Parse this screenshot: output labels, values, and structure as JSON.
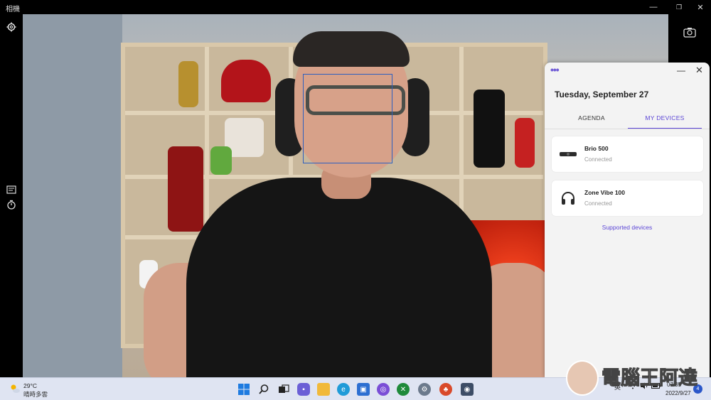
{
  "window": {
    "title": "相機",
    "controls": {
      "minimize": "—",
      "maximize": "❐",
      "close": "✕"
    }
  },
  "camera": {
    "left_toolbar": [
      "settings-icon",
      "pro-controls-icon",
      "timer-icon"
    ],
    "right_toolbar": [
      "switch-camera-icon"
    ]
  },
  "tune_panel": {
    "date": "Tuesday, September 27",
    "tabs": [
      {
        "label": "AGENDA",
        "active": false
      },
      {
        "label": "MY DEVICES",
        "active": true
      }
    ],
    "devices": [
      {
        "name": "Brio 500",
        "status": "Connected",
        "icon": "webcam-icon"
      },
      {
        "name": "Zone Vibe 100",
        "status": "Connected",
        "icon": "headphones-icon"
      }
    ],
    "supported_link": "Supported devices",
    "accent": "#5b45d6"
  },
  "taskbar": {
    "weather": {
      "temp": "29°C",
      "desc": "晴時多雲"
    },
    "apps": [
      "windows-start-icon",
      "search-icon",
      "task-view-icon",
      "teams-chat-icon",
      "file-explorer-icon",
      "edge-icon",
      "store-icon",
      "app-icon",
      "xbox-icon",
      "settings-icon",
      "game-icon",
      "camera-icon"
    ],
    "tray": {
      "ime": "英",
      "time": "07:35",
      "date": "2022/9/27",
      "notifications": "4"
    }
  },
  "watermark": {
    "text": "電腦王阿達"
  }
}
